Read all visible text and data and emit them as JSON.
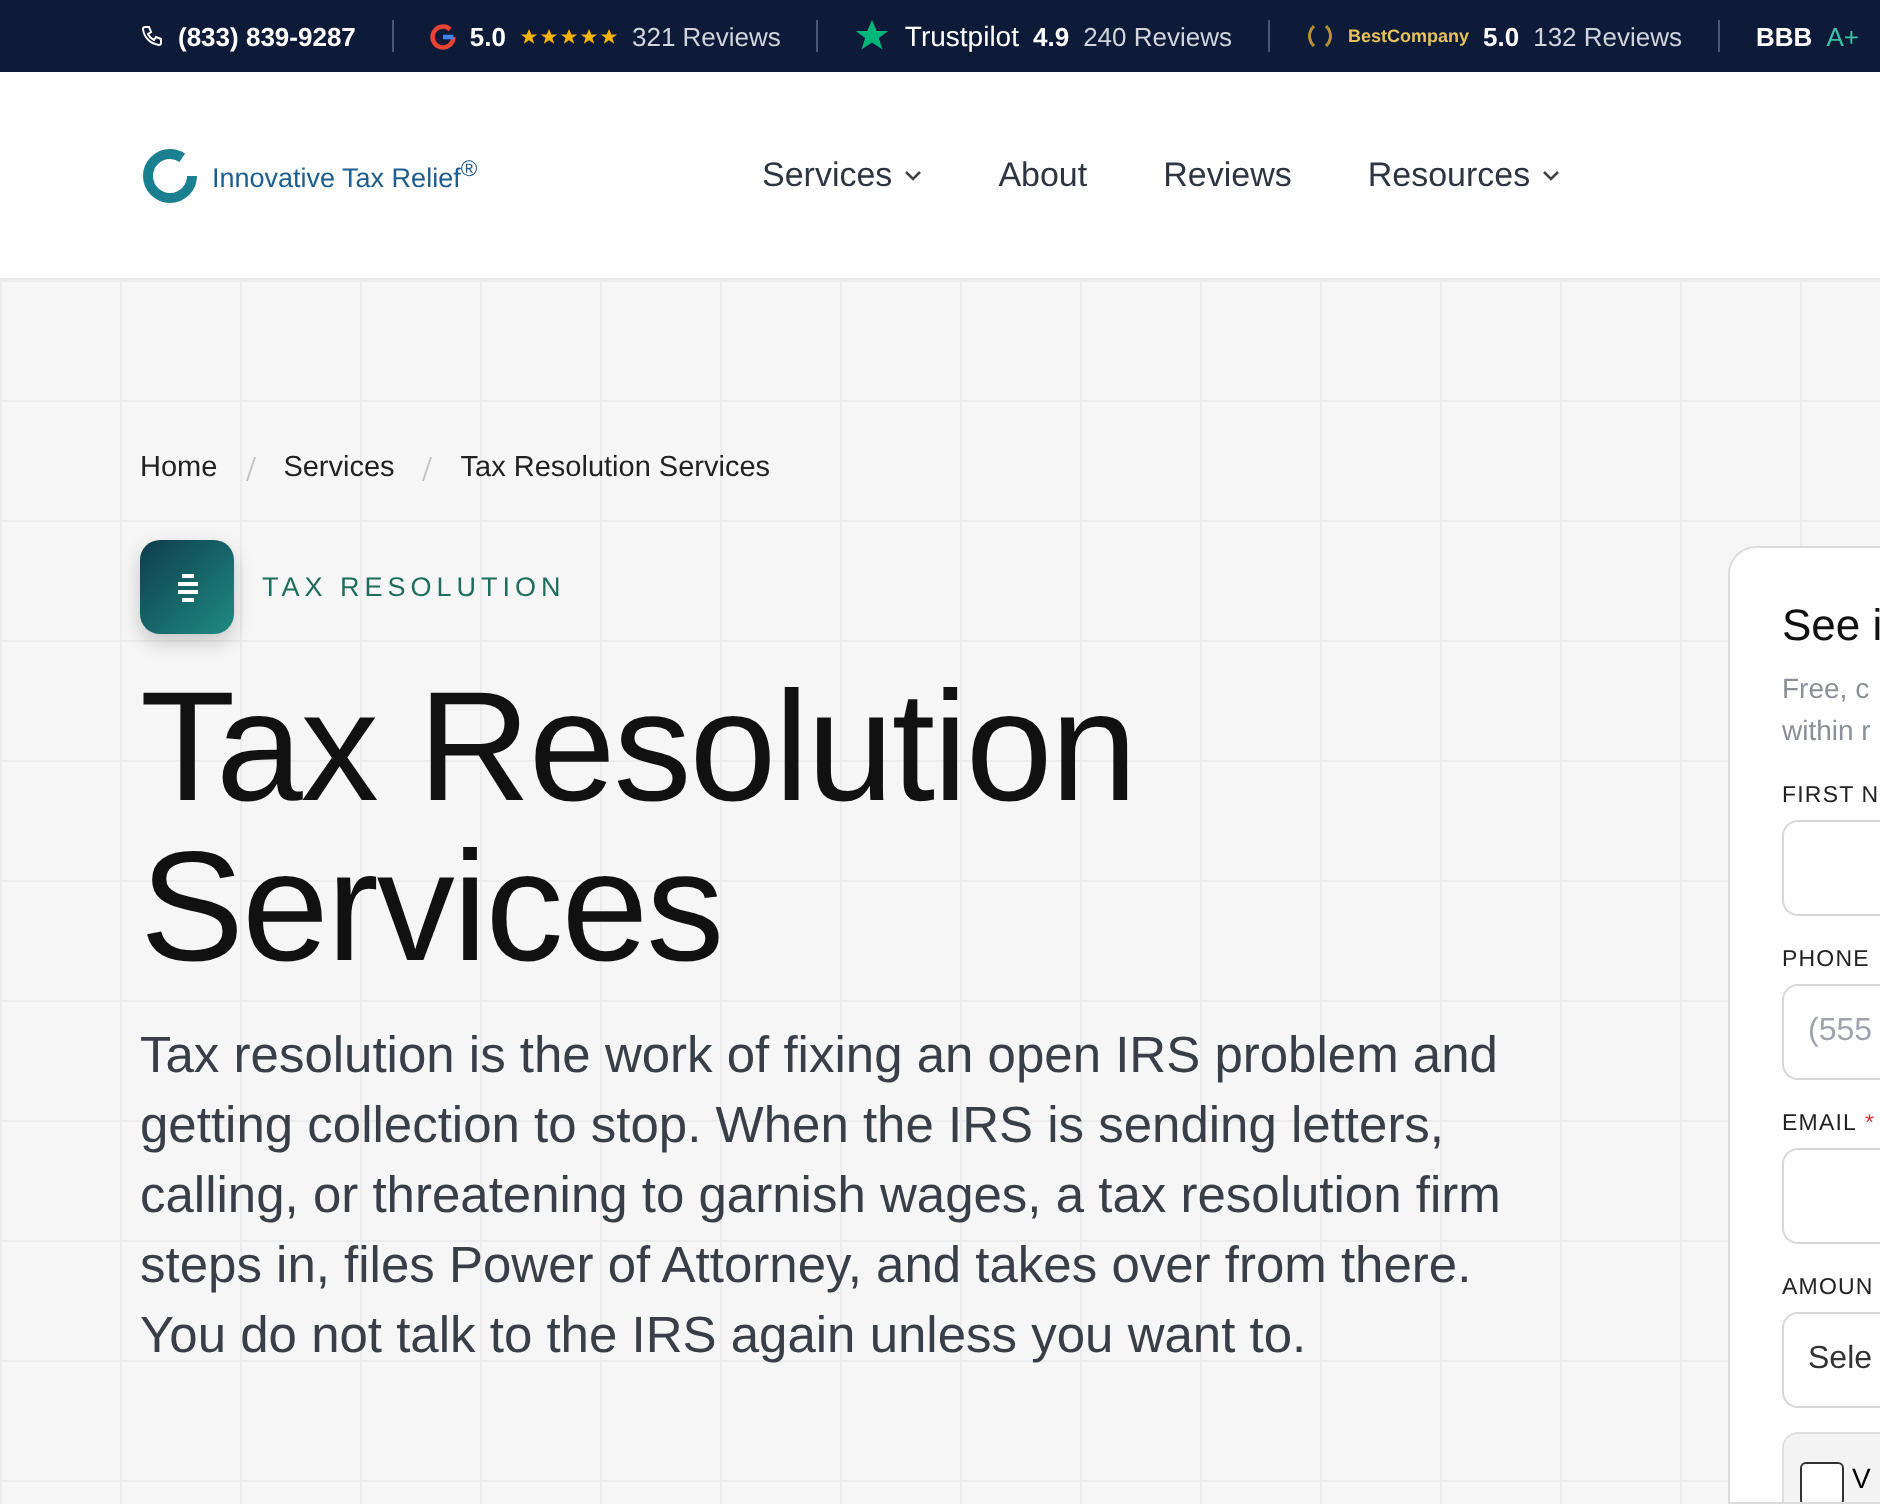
{
  "top_bar": {
    "phone": "(833) 839-9287",
    "ratings": [
      {
        "kind": "google",
        "score": "5.0",
        "stars": 5,
        "reviews": "321 Reviews"
      },
      {
        "kind": "trustpilot",
        "brand": "Trustpilot",
        "score": "4.9",
        "reviews": "240 Reviews"
      },
      {
        "kind": "bestcompany",
        "brand": "BestCompany",
        "score": "5.0",
        "reviews": "132 Reviews"
      },
      {
        "kind": "bbb",
        "brand": "BBB",
        "score": "A+"
      }
    ]
  },
  "header": {
    "logo": "Innovative Tax Relief",
    "logo_mark": "®",
    "nav": [
      {
        "label": "Services",
        "dropdown": true
      },
      {
        "label": "About",
        "dropdown": false
      },
      {
        "label": "Reviews",
        "dropdown": false
      },
      {
        "label": "Resources",
        "dropdown": true
      }
    ]
  },
  "breadcrumb": [
    "Home",
    "Services",
    "Tax Resolution Services"
  ],
  "eyebrow": "TAX RESOLUTION",
  "title": [
    "Tax Resolution",
    "Services"
  ],
  "intro": "Tax resolution is the work of fixing an open IRS problem and getting collection to stop. When the IRS is sending letters, calling, or threatening to garnish wages, a tax resolution firm steps in, files Power of Attorney, and takes over from there. You do not talk to the IRS again unless you want to.",
  "form": {
    "title": "See i",
    "subtitle": [
      "Free, c",
      "within r"
    ],
    "fields": [
      {
        "kind": "input",
        "label": "FIRST N"
      },
      {
        "kind": "input",
        "label": "PHONE",
        "placeholder": "(555"
      },
      {
        "kind": "input",
        "label": "EMAIL",
        "mark": "*"
      },
      {
        "kind": "select",
        "label": "AMOUN",
        "value": "Sele"
      }
    ],
    "consent": {
      "label": "V",
      "checked": false
    }
  }
}
